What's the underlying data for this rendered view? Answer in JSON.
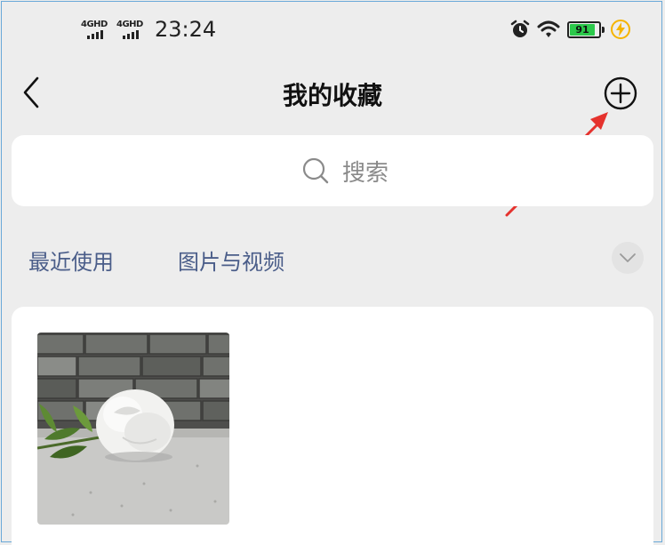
{
  "status_bar": {
    "signal_1_label": "4GHD",
    "signal_2_label": "4GHD",
    "time": "23:24",
    "battery_level": "91",
    "icons": [
      "alarm-icon",
      "wifi-icon",
      "battery-icon",
      "charging-icon"
    ]
  },
  "nav": {
    "title": "我的收藏",
    "back_icon": "back-icon",
    "add_icon": "add-circle-icon"
  },
  "search": {
    "placeholder": "搜索",
    "icon": "search-icon"
  },
  "tabs": [
    {
      "label": "最近使用"
    },
    {
      "label": "图片与视频"
    }
  ],
  "content": {
    "items": [
      {
        "type": "image",
        "description_icon": "photo-white-rose"
      }
    ]
  },
  "colors": {
    "background": "#ededed",
    "tab_text": "#4a5d89",
    "battery_fill": "#2cc94b",
    "charging": "#f5b400",
    "annotation_arrow": "#e5322d"
  }
}
